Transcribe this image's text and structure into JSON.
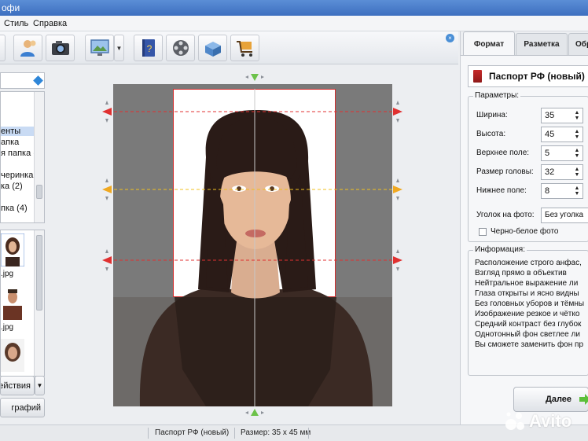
{
  "window": {
    "title": "офи"
  },
  "menu": {
    "style": "Стиль",
    "help": "Справка"
  },
  "left_panel": {
    "tree_items": [
      "енты",
      "апка",
      "я папка (4",
      "",
      "черинка",
      "ка (2)",
      "",
      "пка (4)"
    ],
    "thumb_captions": [
      ".jpg",
      ".jpg"
    ],
    "actions_label": "ействия",
    "photos_label": "графий"
  },
  "right_panel": {
    "tabs": [
      "Формат",
      "Разметка",
      "Обр"
    ],
    "format_name": "Паспорт РФ (новый)",
    "params_title": "Параметры:",
    "params": [
      {
        "label": "Ширина:",
        "value": "35"
      },
      {
        "label": "Высота:",
        "value": "45"
      },
      {
        "label": "Верхнее поле:",
        "value": "5"
      },
      {
        "label": "Размер головы:",
        "value": "32"
      },
      {
        "label": "Нижнее поле:",
        "value": "8"
      }
    ],
    "corner_label": "Уголок на фото:",
    "corner_value": "Без уголка",
    "bw_label": "Черно-белое фото",
    "info_title": "Информация:",
    "info_lines": [
      "Расположение строго анфас,",
      "Взгляд прямо в объектив",
      "Нейтральное выражение ли",
      "Глаза открыты и ясно видны",
      "Без головных уборов и тёмны",
      "Изображение резкое и чётко",
      "Средний контраст без глубок",
      "Однотонный фон светлее ли",
      "Вы сможете заменить фон пр"
    ],
    "next_label": "Далее"
  },
  "status": {
    "format": "Паспорт РФ (новый)",
    "size": "Размер: 35 х 45 мм"
  },
  "watermark": "Avito",
  "colors": {
    "accent": "#2e86d8",
    "guide_red": "#e03030",
    "guide_yellow": "#f0c020",
    "marker_green": "#6cc24a"
  }
}
